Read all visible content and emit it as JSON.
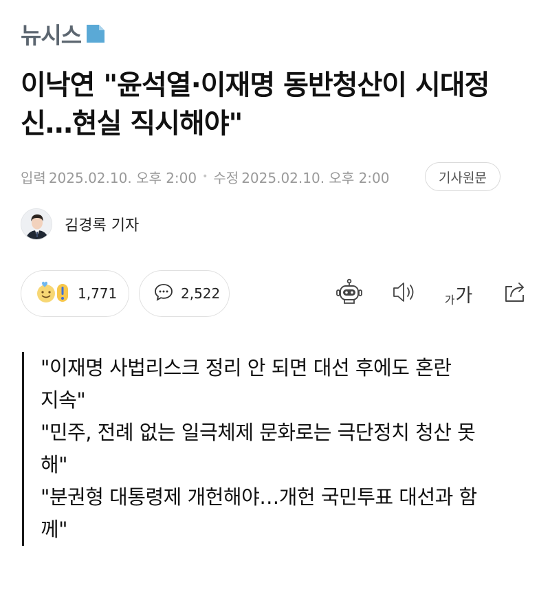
{
  "brand": {
    "logo_text": "뉴시스",
    "accent_color": "#5aa9d6",
    "logo_text_color": "#5c6670"
  },
  "article": {
    "headline": "이낙연 \"윤석열·이재명 동반청산이 시대정신…현실 직시해야\"",
    "published_label": "입력",
    "published_at": "2025.02.10. 오후 2:00",
    "modified_label": "수정",
    "modified_at": "2025.02.10. 오후 2:00",
    "original_button": "기사원문",
    "reporter": "김경록 기자"
  },
  "actions": {
    "reaction_count": "1,771",
    "comment_count": "2,522",
    "icons": [
      "reaction-emoji-icon",
      "comment-icon",
      "robot-summary-icon",
      "speaker-icon",
      "font-size-icon",
      "share-icon"
    ],
    "font_small": "가",
    "font_large": "가"
  },
  "summary": {
    "lines": [
      "\"이재명 사법리스크 정리 안 되면 대선 후에도 혼란",
      "지속\"",
      "\"민주, 전례 없는 일극체제 문화로는 극단정치 청산 못",
      "해\"",
      "\"분권형 대통령제 개헌해야…개헌 국민투표 대선과 함",
      "께\""
    ]
  }
}
